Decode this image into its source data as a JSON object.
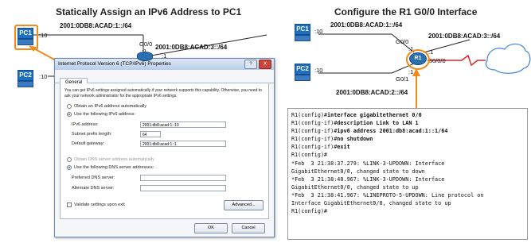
{
  "left": {
    "title": "Statically Assign an IPv6 Address to PC1",
    "pc1": "PC1",
    "pc2": "PC2",
    "pc1_if": ":10",
    "pc2_if": ":10",
    "net1": "2001:0DB8:ACAD:1::/64",
    "net3": "2001:0DB8:ACAD:3::/64",
    "g00": "G0/0",
    "r_if": ":1",
    "r_if2": ":1"
  },
  "dialog": {
    "title": "Internet Protocol Version 6 (TCP/IPv6) Properties",
    "help_btn": "?",
    "close_btn": "X",
    "tab": "General",
    "description": "You can get IPv6 settings assigned automatically if your network supports this capability. Otherwise, you need to ask your network administrator for the appropriate IPv6 settings.",
    "auto_ip": "Obtain an IPv6 address automatically",
    "use_ip": "Use the following IPv6 address:",
    "ipv6_label": "IPv6 address:",
    "ipv6_value": "2001:db8:acad:1::10",
    "prefix_label": "Subnet prefix length:",
    "prefix_value": "64",
    "gw_label": "Default gateway:",
    "gw_value": "2001:db8:acad:1::1",
    "auto_dns": "Obtain DNS server address automatically",
    "use_dns": "Use the following DNS server addresses:",
    "pref_dns_label": "Preferred DNS server:",
    "alt_dns_label": "Alternate DNS server:",
    "validate": "Validate settings upon exit",
    "advanced_btn": "Advanced...",
    "ok_btn": "OK",
    "cancel_btn": "Cancel"
  },
  "right": {
    "title": "Configure the R1 G0/0 Interface",
    "pc1": "PC1",
    "pc2": "PC2",
    "pc1_if": ":10",
    "pc2_if": ":10",
    "net1": "2001:0DB8:ACAD:1::/64",
    "net2": "2001:0DB8:ACAD:2::/64",
    "net3": "2001:0DB8:ACAD:3::/64",
    "g00": "G0/0",
    "g01": "G0/1",
    "s000": "S0/0/0",
    "r1": "R1",
    "r_if_a": ":1",
    "r_if_b": ":1",
    "r_if_c": ":1"
  },
  "cli_lines": [
    {
      "p": "R1(config)#",
      "c": "interface gigabitethernet 0/0"
    },
    {
      "p": "R1(config-if)#",
      "c": "description Link to LAN 1"
    },
    {
      "p": "R1(config-if)#",
      "c": "ipv6 address 2001:db8:acad:1::1/64"
    },
    {
      "p": "R1(config-if)#",
      "c": "no shutdown"
    },
    {
      "p": "R1(config-if)#",
      "c": "exit"
    },
    {
      "p": "R1(config)#",
      "c": ""
    },
    {
      "p": "*Feb  3 21:38:37.279: %LINK-3-UPDOWN: Interface",
      "c": ""
    },
    {
      "p": "GigabitEthernet0/0, changed state to down",
      "c": ""
    },
    {
      "p": "*Feb  3 21:38:40.967: %LINK-3-UPDOWN: Interface",
      "c": ""
    },
    {
      "p": "GigabitEthernet0/0, changed state to up",
      "c": ""
    },
    {
      "p": "*Feb  3 21:38:41.967: %LINEPROTO-5-UPDOWN: Line protocol on",
      "c": ""
    },
    {
      "p": "Interface GigabitEthernet0/0, changed state to up",
      "c": ""
    },
    {
      "p": "R1(config)#",
      "c": ""
    }
  ],
  "colors": {
    "pc_blue": "#1e6fbf",
    "highlight_orange": "#f28a1a",
    "router_blue": "#2a6fb2",
    "serial_red": "#d9262b"
  }
}
